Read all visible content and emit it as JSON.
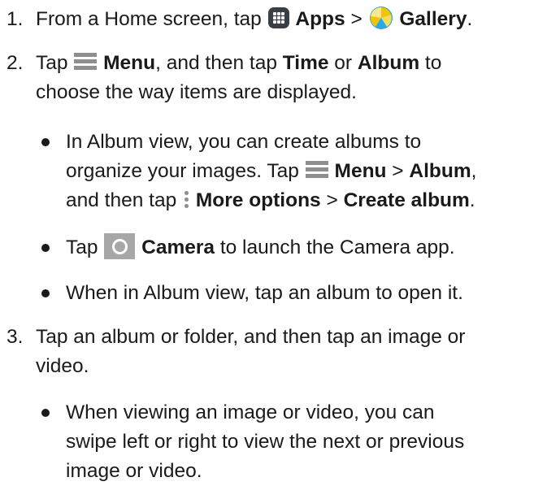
{
  "steps": [
    {
      "number": "1.",
      "parts": [
        "From a Home screen, tap ",
        "Apps",
        " > ",
        "Gallery",
        "."
      ]
    },
    {
      "number": "2.",
      "line1": [
        "Tap ",
        "Menu",
        ", and then tap ",
        "Time",
        " or ",
        "Album",
        " to"
      ],
      "line2": "choose the way items are displayed.",
      "bullets": [
        {
          "line1": "In Album view, you can create albums to",
          "line2": [
            "organize your images. Tap ",
            "Menu",
            " > ",
            "Album",
            ","
          ],
          "line3": [
            "and then tap ",
            "More options",
            " > ",
            "Create album",
            "."
          ]
        },
        {
          "parts": [
            "Tap ",
            "Camera",
            " to launch the Camera app."
          ]
        },
        {
          "text": "When in Album view, tap an album to open it."
        }
      ]
    },
    {
      "number": "3.",
      "line1": "Tap an album or folder, and then tap an image or",
      "line2": "video.",
      "bullets": [
        {
          "line1": "When viewing an image or video, you can",
          "line2": "swipe left or right to view the next or previous",
          "line3": "image or video."
        }
      ]
    }
  ],
  "icons": {
    "apps": "apps-grid-icon",
    "gallery": "gallery-pinwheel-icon",
    "menu": "menu-icon",
    "more_options": "more-options-icon",
    "camera": "camera-icon"
  },
  "colors": {
    "text": "#1a1a1a",
    "icon_gray": "#8e8e8e",
    "apps_bg": "#3a3f45",
    "gallery_yellow": "#f5c400",
    "gallery_blue": "#2aa7e6"
  }
}
